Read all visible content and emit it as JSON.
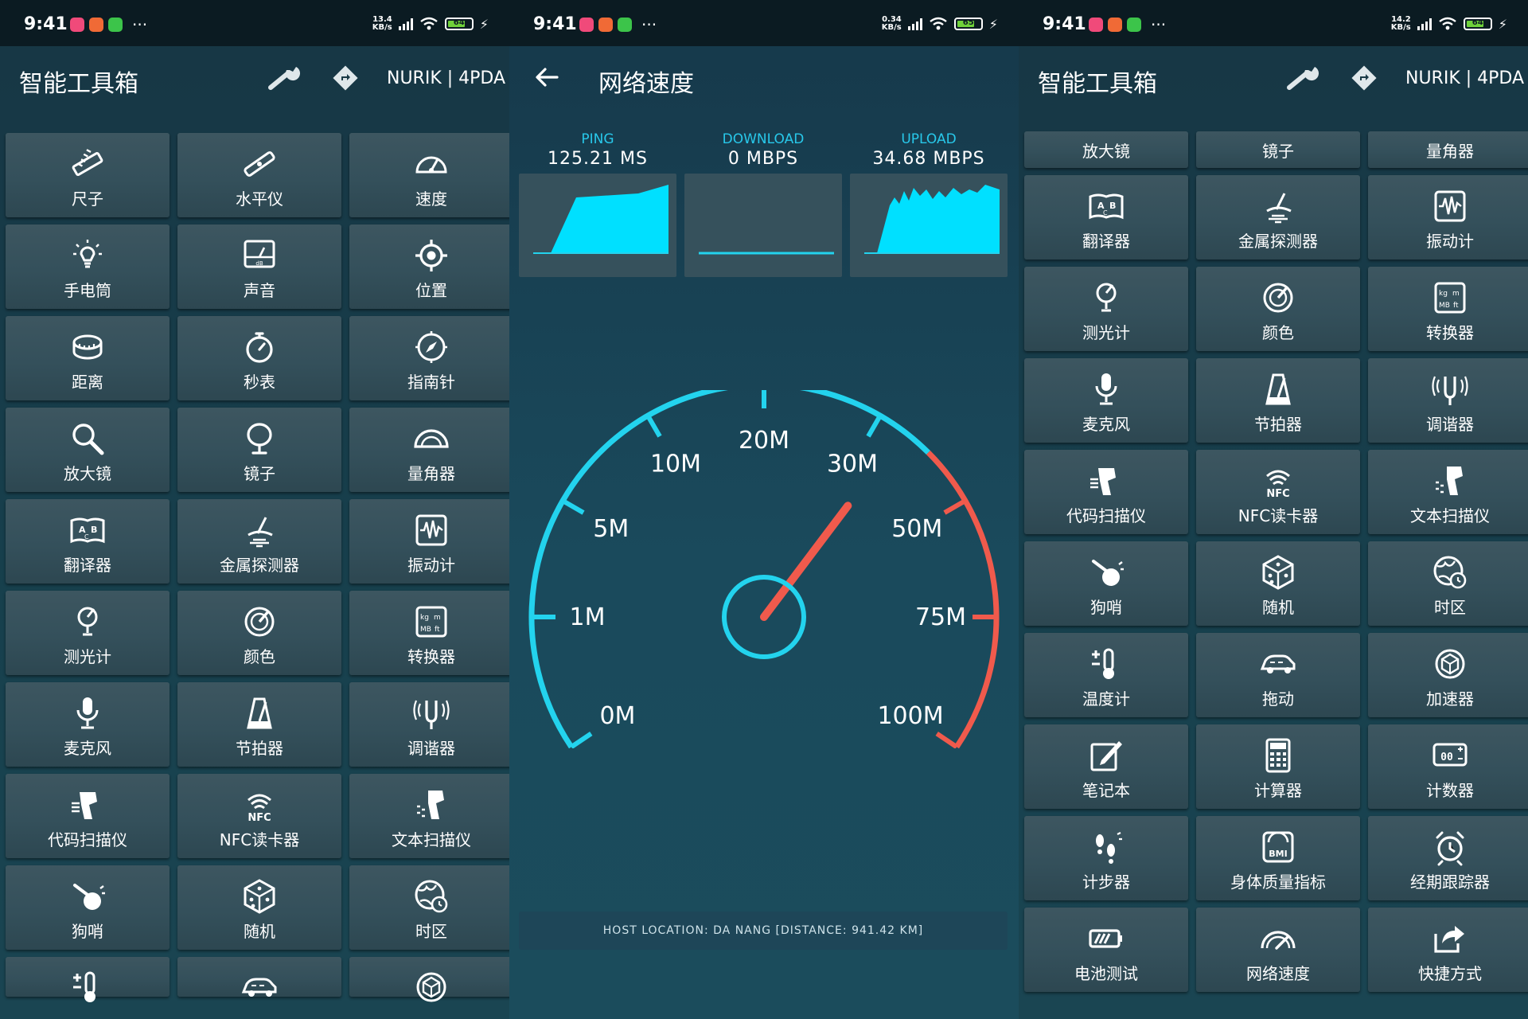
{
  "status_bars": [
    {
      "time": "9:41",
      "speed_top": "13.4",
      "speed_bottom": "KB/s",
      "battery": "64"
    },
    {
      "time": "9:41",
      "speed_top": "0.34",
      "speed_bottom": "KB/s",
      "battery": "65"
    },
    {
      "time": "9:41",
      "speed_top": "14.2",
      "speed_bottom": "KB/s",
      "battery": "64"
    }
  ],
  "toolbox": {
    "title": "智能工具箱",
    "credit": "NURIK | 4PDA",
    "tools_left": [
      {
        "label": "尺子",
        "icon": "ruler-icon"
      },
      {
        "label": "水平仪",
        "icon": "level-icon"
      },
      {
        "label": "速度",
        "icon": "speedometer-icon"
      },
      {
        "label": "手电筒",
        "icon": "flashlight-icon"
      },
      {
        "label": "声音",
        "icon": "sound-meter-icon"
      },
      {
        "label": "位置",
        "icon": "location-icon"
      },
      {
        "label": "距离",
        "icon": "tape-measure-icon"
      },
      {
        "label": "秒表",
        "icon": "stopwatch-icon"
      },
      {
        "label": "指南针",
        "icon": "compass-icon"
      },
      {
        "label": "放大镜",
        "icon": "magnifier-icon"
      },
      {
        "label": "镜子",
        "icon": "mirror-icon"
      },
      {
        "label": "量角器",
        "icon": "protractor-icon"
      },
      {
        "label": "翻译器",
        "icon": "translator-icon"
      },
      {
        "label": "金属探测器",
        "icon": "metal-detector-icon"
      },
      {
        "label": "振动计",
        "icon": "vibrometer-icon"
      },
      {
        "label": "测光计",
        "icon": "light-meter-icon"
      },
      {
        "label": "颜色",
        "icon": "color-picker-icon"
      },
      {
        "label": "转换器",
        "icon": "converter-icon"
      },
      {
        "label": "麦克风",
        "icon": "microphone-icon"
      },
      {
        "label": "节拍器",
        "icon": "metronome-icon"
      },
      {
        "label": "调谐器",
        "icon": "tuner-icon"
      },
      {
        "label": "代码扫描仪",
        "icon": "barcode-scanner-icon"
      },
      {
        "label": "NFC读卡器",
        "icon": "nfc-icon"
      },
      {
        "label": "文本扫描仪",
        "icon": "text-scanner-icon"
      },
      {
        "label": "狗哨",
        "icon": "dog-whistle-icon"
      },
      {
        "label": "随机",
        "icon": "dice-icon"
      },
      {
        "label": "时区",
        "icon": "world-clock-icon"
      }
    ],
    "tools_left_partial": [
      {
        "icon": "thermometer-icon"
      },
      {
        "icon": "car-icon"
      },
      {
        "icon": "accelerometer-icon"
      }
    ],
    "tools_right_head": [
      "放大镜",
      "镜子",
      "量角器"
    ],
    "tools_right": [
      {
        "label": "翻译器",
        "icon": "translator-icon"
      },
      {
        "label": "金属探测器",
        "icon": "metal-detector-icon"
      },
      {
        "label": "振动计",
        "icon": "vibrometer-icon"
      },
      {
        "label": "测光计",
        "icon": "light-meter-icon"
      },
      {
        "label": "颜色",
        "icon": "color-picker-icon"
      },
      {
        "label": "转换器",
        "icon": "converter-icon"
      },
      {
        "label": "麦克风",
        "icon": "microphone-icon"
      },
      {
        "label": "节拍器",
        "icon": "metronome-icon"
      },
      {
        "label": "调谐器",
        "icon": "tuner-icon"
      },
      {
        "label": "代码扫描仪",
        "icon": "barcode-scanner-icon"
      },
      {
        "label": "NFC读卡器",
        "icon": "nfc-icon"
      },
      {
        "label": "文本扫描仪",
        "icon": "text-scanner-icon"
      },
      {
        "label": "狗哨",
        "icon": "dog-whistle-icon"
      },
      {
        "label": "随机",
        "icon": "dice-icon"
      },
      {
        "label": "时区",
        "icon": "world-clock-icon"
      },
      {
        "label": "温度计",
        "icon": "thermometer-icon"
      },
      {
        "label": "拖动",
        "icon": "car-icon"
      },
      {
        "label": "加速器",
        "icon": "accelerometer-icon"
      },
      {
        "label": "笔记本",
        "icon": "notebook-icon"
      },
      {
        "label": "计算器",
        "icon": "calculator-icon"
      },
      {
        "label": "计数器",
        "icon": "counter-icon"
      },
      {
        "label": "计步器",
        "icon": "pedometer-icon"
      },
      {
        "label": "身体质量指标",
        "icon": "bmi-icon"
      },
      {
        "label": "经期跟踪器",
        "icon": "alarm-tracker-icon"
      },
      {
        "label": "电池测试",
        "icon": "battery-test-icon"
      },
      {
        "label": "网络速度",
        "icon": "network-speed-icon"
      },
      {
        "label": "快捷方式",
        "icon": "shortcut-icon"
      }
    ]
  },
  "speedtest": {
    "title": "网络速度",
    "ping_label": "PING",
    "ping_value": "125.21 MS",
    "download_label": "DOWNLOAD",
    "download_value": "0 MBPS",
    "upload_label": "UPLOAD",
    "upload_value": "34.68 MBPS",
    "host": "HOST LOCATION: DA NANG [DISTANCE: 941.42 KM]",
    "gauge": {
      "labels": [
        "0M",
        "1M",
        "5M",
        "10M",
        "20M",
        "30M",
        "50M",
        "75M",
        "100M"
      ],
      "needle_mbps": 34.68
    },
    "colors": {
      "accent": "#23d3ee",
      "danger": "#f05a4c",
      "fill": "#00e0ff"
    }
  }
}
